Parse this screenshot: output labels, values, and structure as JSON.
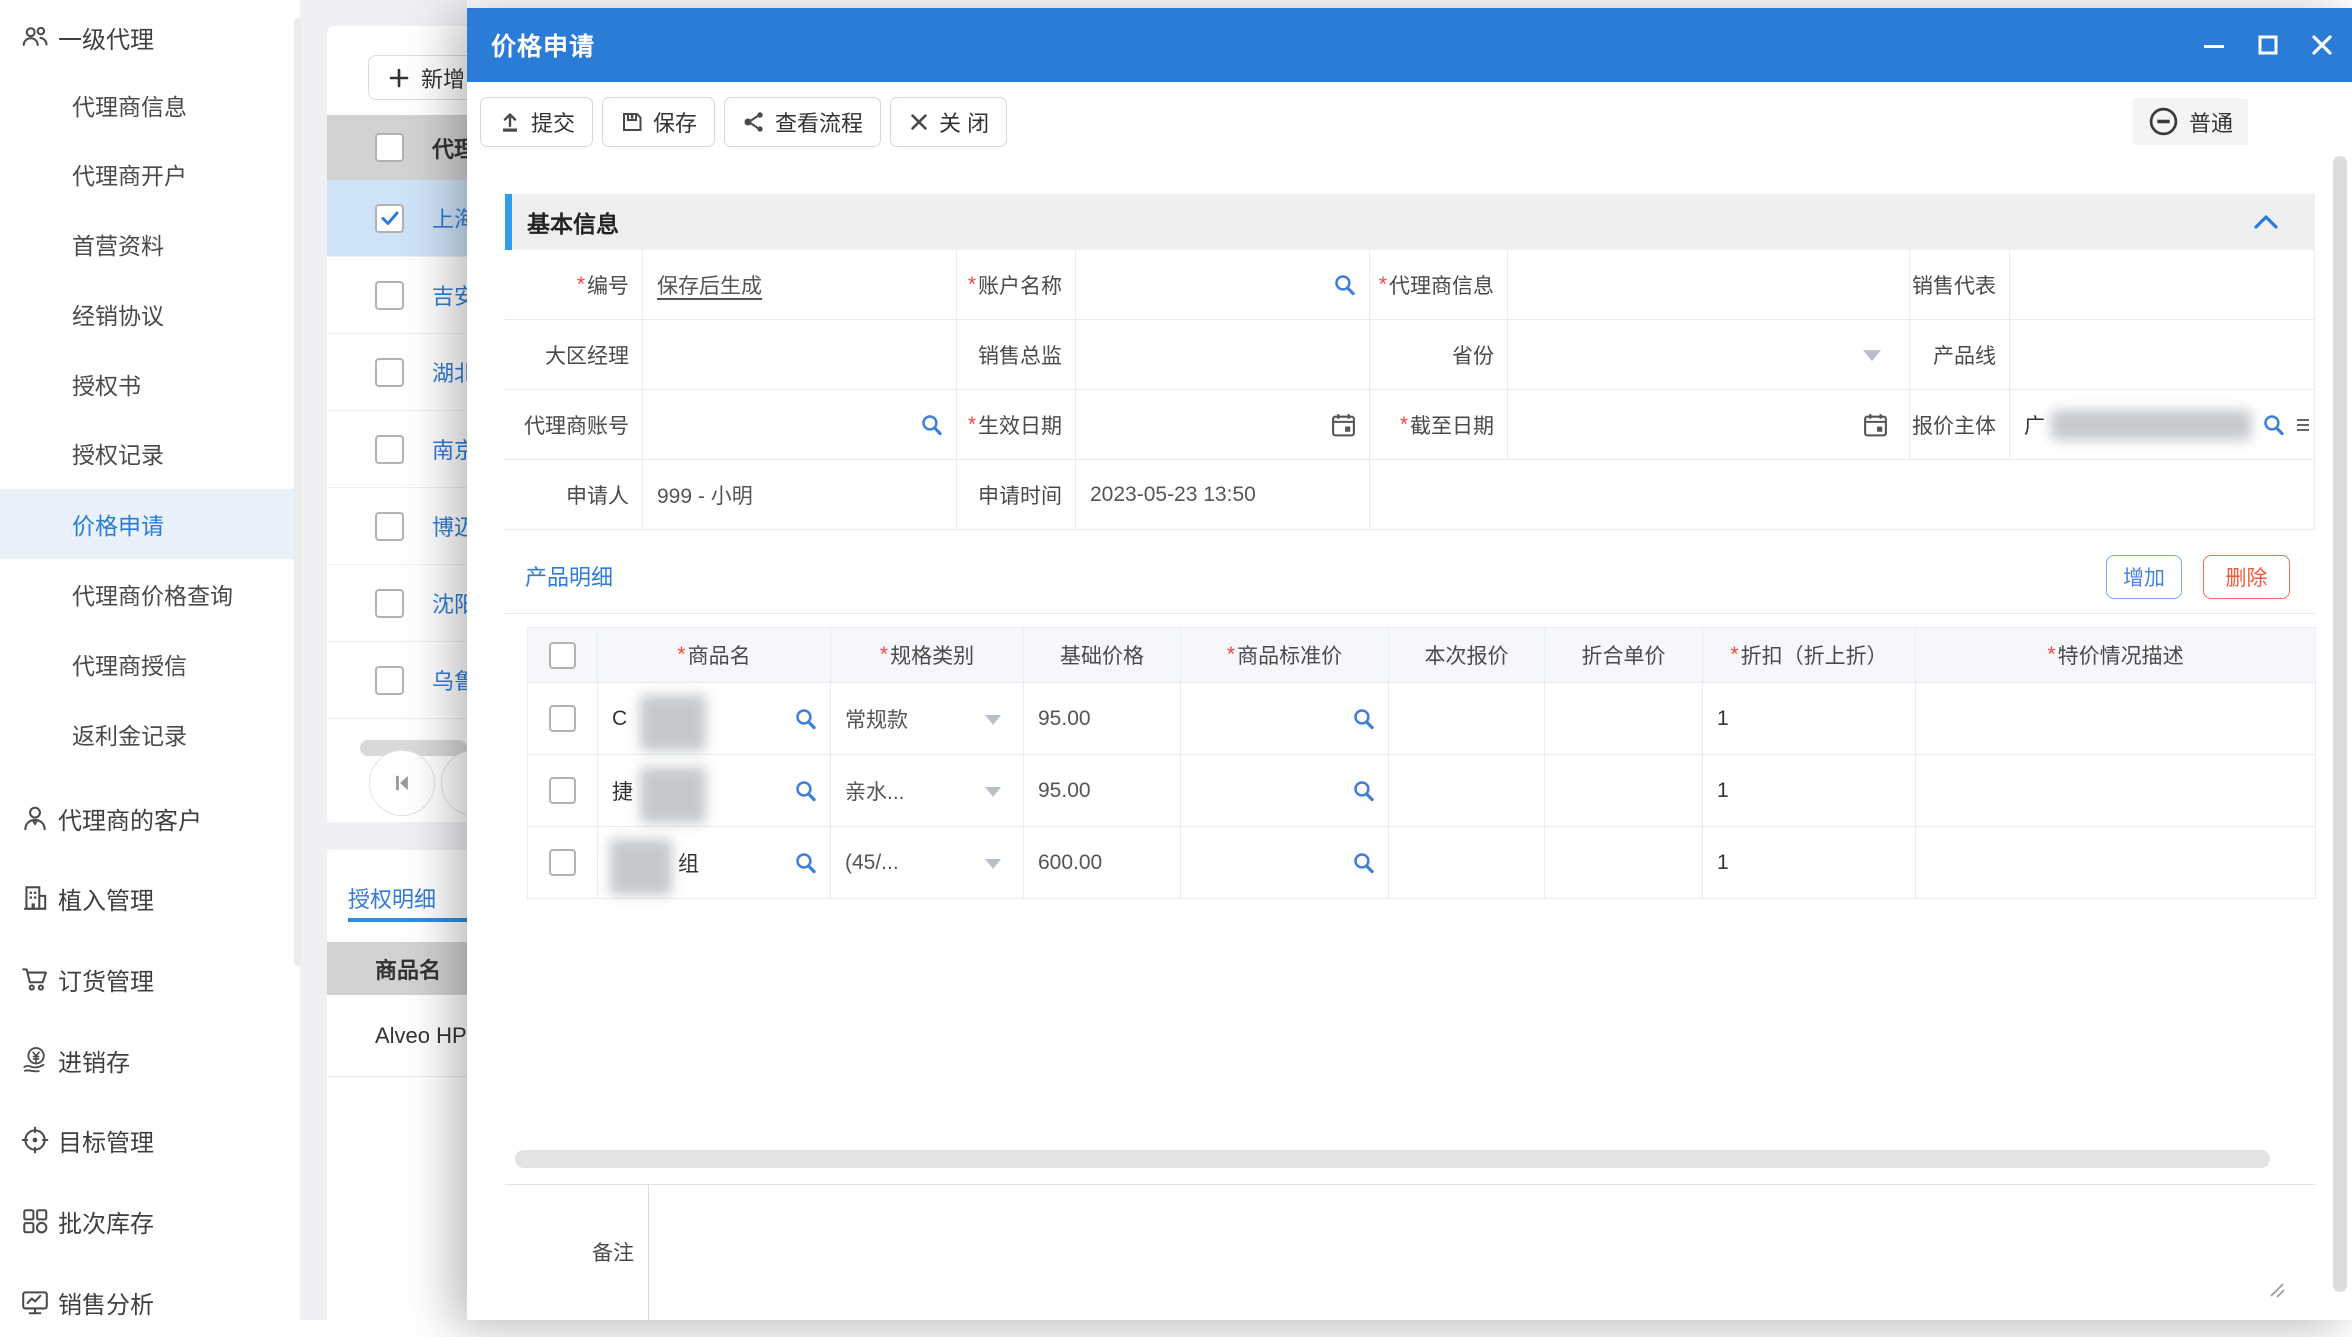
{
  "ui": {
    "required_mark": "*"
  },
  "theme": {
    "titlebar_blue": "#2b7cd6",
    "section_accent_blue": "#2ba0e6",
    "link_blue": "#2f7bd9",
    "danger_red": "#ee5a3c",
    "required_red": "#f5453d",
    "selected_row_blue": "#cfe3f7",
    "header_gray": "#d2d2d2"
  },
  "icons": {
    "people-icon": "two-person outline",
    "person-icon": "single person outline",
    "building-icon": "building outline",
    "cart-icon": "shopping cart",
    "coin-hand-icon": "hand holding yen coin",
    "target-icon": "crosshair target",
    "grid-icon": "grid of shapes",
    "chart-monitor-icon": "monitor with line chart",
    "plus-icon": "+",
    "check-icon": "✓",
    "search-icon": "magnifier",
    "calendar-icon": "calendar",
    "caret-down-icon": "▼",
    "upload-icon": "arrow up over bar",
    "save-icon": "floppy disk",
    "share-icon": "share dots",
    "close-icon": "✕",
    "minimize-icon": "—",
    "maximize-icon": "□",
    "circle-minus-icon": "⊖",
    "chevron-up-icon": "^",
    "first-page-icon": "|◀",
    "prev-page-icon": "◀",
    "list-icon": "≡",
    "resize-icon": "⸌⸌"
  },
  "sidebar": {
    "items": [
      {
        "label": "一级代理",
        "level": 0,
        "icon": "people-icon"
      },
      {
        "label": "代理商信息",
        "level": 1
      },
      {
        "label": "代理商开户",
        "level": 1
      },
      {
        "label": "首营资料",
        "level": 1
      },
      {
        "label": "经销协议",
        "level": 1
      },
      {
        "label": "授权书",
        "level": 1
      },
      {
        "label": "授权记录",
        "level": 1
      },
      {
        "label": "价格申请",
        "level": 1,
        "active": true
      },
      {
        "label": "代理商价格查询",
        "level": 1
      },
      {
        "label": "代理商授信",
        "level": 1
      },
      {
        "label": "返利金记录",
        "level": 1
      },
      {
        "label": "代理商的客户",
        "level": 0,
        "icon": "person-icon"
      },
      {
        "label": "植入管理",
        "level": 0,
        "icon": "building-icon"
      },
      {
        "label": "订货管理",
        "level": 0,
        "icon": "cart-icon"
      },
      {
        "label": "进销存",
        "level": 0,
        "icon": "coin-hand-icon"
      },
      {
        "label": "目标管理",
        "level": 0,
        "icon": "target-icon"
      },
      {
        "label": "批次库存",
        "level": 0,
        "icon": "grid-icon"
      },
      {
        "label": "销售分析",
        "level": 0,
        "icon": "chart-monitor-icon"
      }
    ]
  },
  "background_window": {
    "add_button_label": "新增",
    "table_header": "代理",
    "rows": [
      {
        "label": "上海",
        "checked": true
      },
      {
        "label": "吉安",
        "checked": false
      },
      {
        "label": "湖北",
        "checked": false
      },
      {
        "label": "南京",
        "checked": false
      },
      {
        "label": "博迈",
        "checked": false
      },
      {
        "label": "沈阳",
        "checked": false
      },
      {
        "label": "乌鲁",
        "checked": false
      }
    ],
    "tab_label": "授权明细",
    "detail_table_header": "商品名",
    "detail_rows": [
      "Alveo HP"
    ]
  },
  "modal": {
    "title": "价格申请",
    "toolbar": {
      "submit": "提交",
      "save": "保存",
      "view_flow": "查看流程",
      "close": "关 闭",
      "priority": "普通"
    },
    "basic_info": {
      "title": "基本信息",
      "rows": [
        [
          {
            "label": "编号",
            "required": true,
            "value": "保存后生成"
          },
          {
            "label": "账户名称",
            "required": true,
            "icon": "search-icon"
          },
          {
            "label": "代理商信息",
            "required": true
          },
          {
            "label": "销售代表"
          }
        ],
        [
          {
            "label": "大区经理"
          },
          {
            "label": "销售总监"
          },
          {
            "label": "省份",
            "icon": "caret-down-icon"
          },
          {
            "label": "产品线"
          }
        ],
        [
          {
            "label": "代理商账号",
            "icon": "search-icon"
          },
          {
            "label": "生效日期",
            "required": true,
            "icon": "calendar-icon"
          },
          {
            "label": "截至日期",
            "required": true,
            "icon": "calendar-icon"
          },
          {
            "label": "报价主体",
            "value": "广",
            "redacted": true,
            "icon": "search-icon"
          }
        ],
        [
          {
            "label": "申请人",
            "value": "999 - 小明"
          },
          {
            "label": "申请时间",
            "value": "2023-05-23 13:50"
          }
        ]
      ]
    },
    "product_detail": {
      "title": "产品明细",
      "add_button": "增加",
      "delete_button": "删除",
      "columns": [
        {
          "label": "商品名",
          "required": true
        },
        {
          "label": "规格类别",
          "required": true
        },
        {
          "label": "基础价格",
          "required": false
        },
        {
          "label": "商品标准价",
          "required": true
        },
        {
          "label": "本次报价",
          "required": false
        },
        {
          "label": "折合单价",
          "required": false
        },
        {
          "label": "折扣（折上折）",
          "required": true
        },
        {
          "label": "特价情况描述",
          "required": true
        }
      ],
      "rows": [
        {
          "name": "C",
          "name_redacted": true,
          "spec": "常规款",
          "base_price": "95.00",
          "discount": "1"
        },
        {
          "name": "捷",
          "name_redacted": true,
          "spec": "亲水...",
          "base_price": "95.00",
          "discount": "1"
        },
        {
          "name": "组",
          "name_prefix_redacted": true,
          "spec": "(45/...",
          "base_price": "600.00",
          "discount": "1"
        }
      ]
    },
    "remark_label": "备注"
  }
}
